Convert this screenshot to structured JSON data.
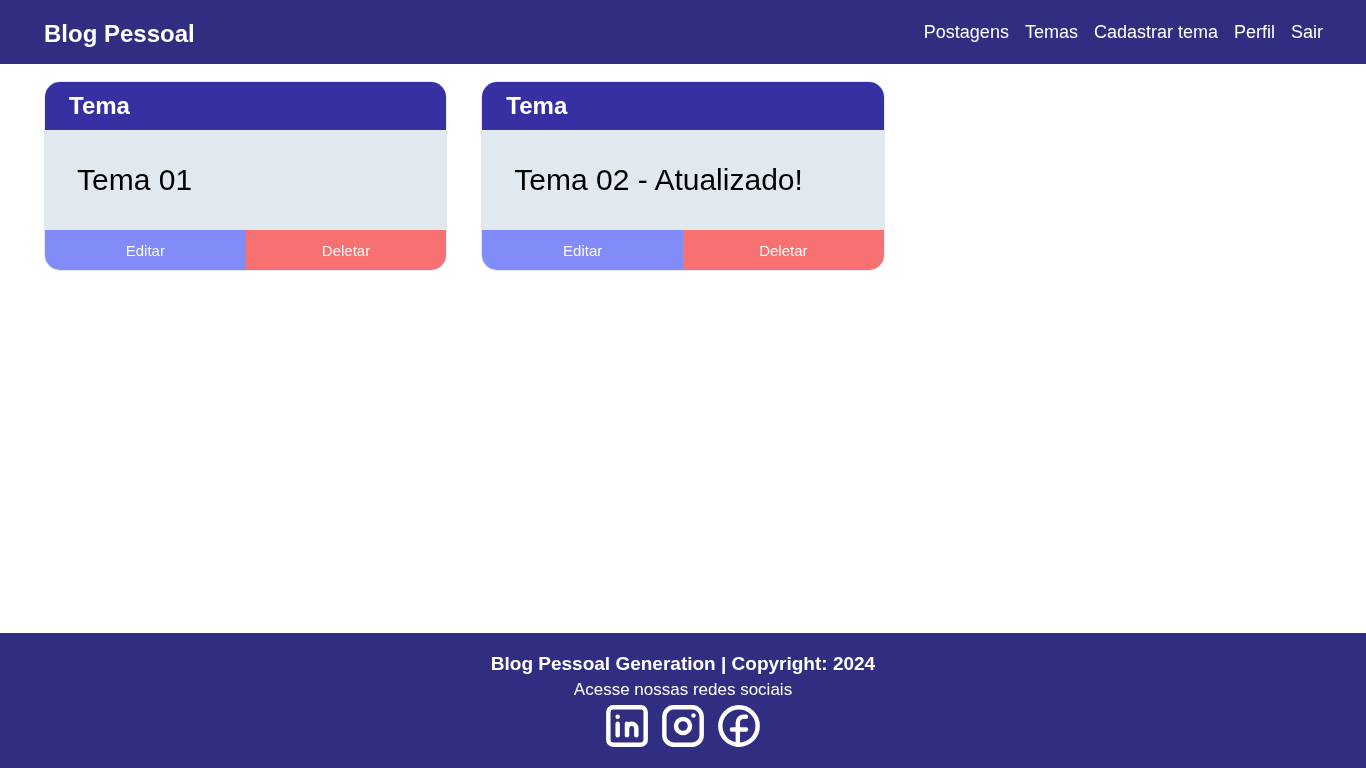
{
  "header": {
    "logo": "Blog Pessoal",
    "nav": [
      "Postagens",
      "Temas",
      "Cadastrar tema",
      "Perfil",
      "Sair"
    ]
  },
  "cards": [
    {
      "title": "Tema",
      "description": "Tema 01",
      "buttons": [
        {
          "label": "Editar",
          "kind": "edit"
        },
        {
          "label": "Deletar",
          "kind": "delete"
        }
      ]
    },
    {
      "title": "Tema",
      "description": "Tema 02 - Atualizado!",
      "buttons": [
        {
          "label": "Editar",
          "kind": "edit"
        },
        {
          "label": "Deletar",
          "kind": "delete"
        }
      ]
    }
  ],
  "footer": {
    "copyright": "Blog Pessoal Generation | Copyright: 2024",
    "social_caption": "Acesse nossas redes sociais",
    "social_links": [
      {
        "kind": "linkedin"
      },
      {
        "kind": "instagram"
      },
      {
        "kind": "facebook"
      }
    ]
  }
}
